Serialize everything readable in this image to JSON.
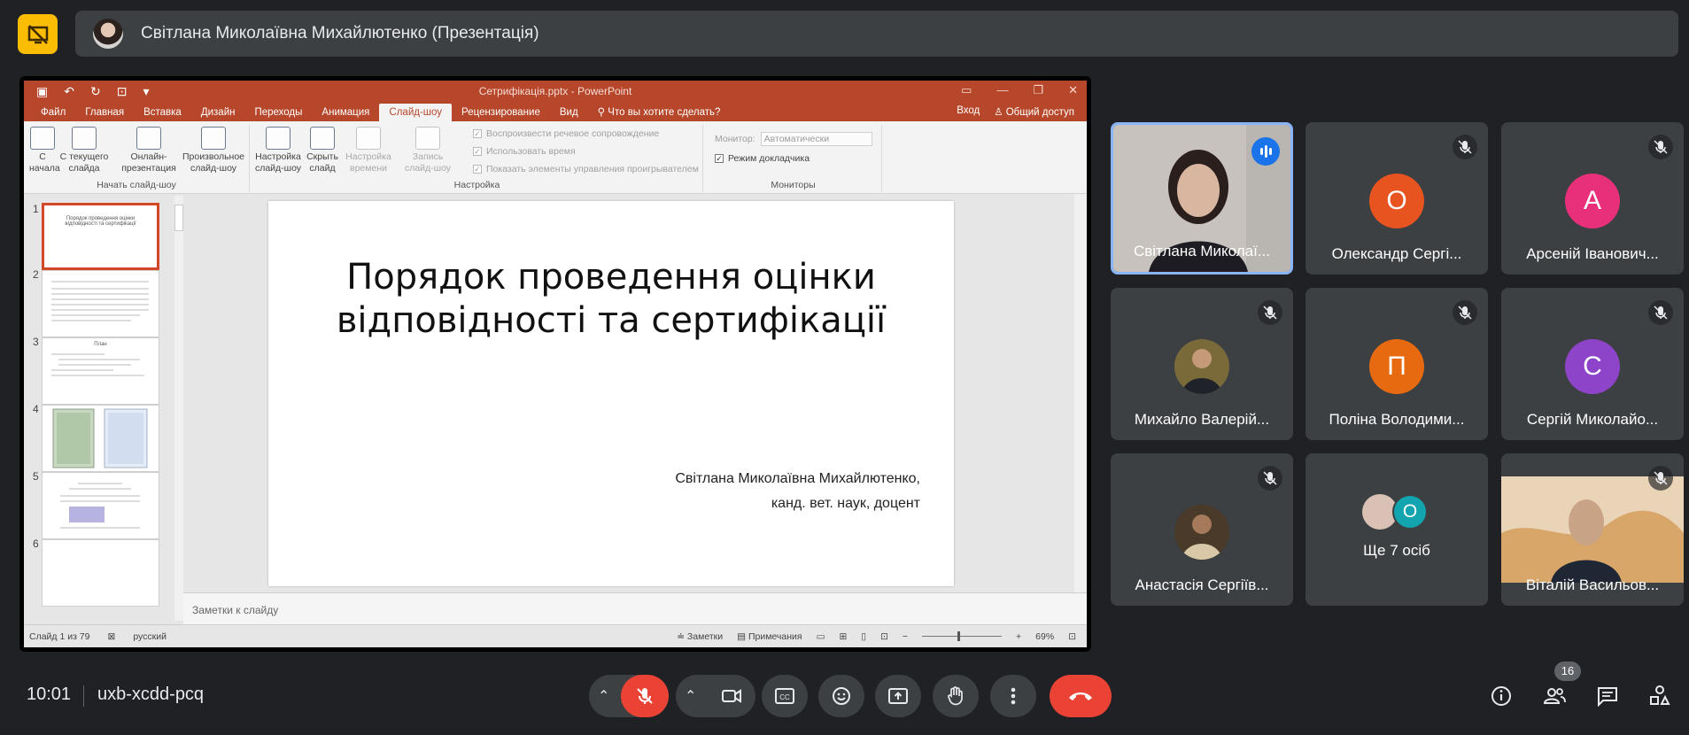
{
  "meet": {
    "presenter_title": "Світлана Миколаївна Михайлютенко (Презентація)",
    "time": "10:01",
    "meeting_code": "uxb-xcdd-pcq",
    "participant_count": "16"
  },
  "colors": {
    "background": "#202124",
    "tile": "#3c4043",
    "accent_blue": "#8ab4f8",
    "end_call_red": "#ea4335",
    "powerpoint_orange": "#b7472a"
  },
  "powerpoint": {
    "doc_title": "Сетрифікація.pptx - PowerPoint",
    "menu": [
      "Файл",
      "Главная",
      "Вставка",
      "Дизайн",
      "Переходы",
      "Анимация",
      "Слайд-шоу",
      "Рецензирование",
      "Вид"
    ],
    "active_menu": "Слайд-шоу",
    "tell_me": "Что вы хотите сделать?",
    "sign_in": "Вход",
    "share": "Общий доступ",
    "ribbon": {
      "from_start": "С начала",
      "from_current": "С текущего слайда",
      "online": "Онлайн-презентация",
      "custom": "Произвольное слайд-шоу",
      "group_start": "Начать слайд-шоу",
      "setup": "Настройка слайд-шоу",
      "hide": "Скрыть слайд",
      "rehearse": "Настройка времени",
      "record": "Запись слайд-шоу",
      "play_narration": "Воспроизвести речевое сопровождение",
      "use_timings": "Использовать время",
      "show_controls": "Показать элементы управления проигрывателем",
      "group_setup": "Настройка",
      "monitor_label": "Монитор:",
      "monitor_value": "Автоматически",
      "presenter_view": "Режим докладчика",
      "group_monitors": "Мониторы"
    },
    "thumbnails": [
      {
        "num": "1",
        "text": "Порядок проведення оцінки відповідності та сертифікації"
      },
      {
        "num": "2",
        "text": ""
      },
      {
        "num": "3",
        "text": "План"
      },
      {
        "num": "4",
        "text": ""
      },
      {
        "num": "5",
        "text": ""
      },
      {
        "num": "6",
        "text": ""
      }
    ],
    "slide": {
      "title": "Порядок проведення оцінки відповідності та сертифікації",
      "author": "Світлана Миколаївна Михайлютенко,",
      "degree": "канд. вет. наук, доцент"
    },
    "notes_placeholder": "Заметки к слайду",
    "status": {
      "slide_info": "Слайд 1 из 79",
      "language": "русский",
      "notes": "Заметки",
      "comments": "Примечания",
      "zoom": "69%"
    }
  },
  "participants": [
    {
      "name": "Світлана Миколаї...",
      "type": "video",
      "speaking": true
    },
    {
      "name": "Олександр Сергі...",
      "initial": "О",
      "color": "#e8541f",
      "muted": true
    },
    {
      "name": "Арсеній Іванович...",
      "initial": "А",
      "color": "#e8307a",
      "muted": true
    },
    {
      "name": "Михайло Валерій...",
      "type": "photo",
      "muted": true
    },
    {
      "name": "Поліна Володими...",
      "initial": "П",
      "color": "#e86a10",
      "muted": true
    },
    {
      "name": "Сергій Миколайо...",
      "initial": "С",
      "color": "#8e44c9",
      "muted": true
    },
    {
      "name": "Анастасія Сергіїв...",
      "type": "photo",
      "muted": true
    },
    {
      "name": "Ще 7 осіб",
      "type": "more",
      "initial": "О",
      "color": "#12a4af"
    },
    {
      "name": "Віталій Васильов...",
      "type": "video",
      "muted": true
    }
  ]
}
